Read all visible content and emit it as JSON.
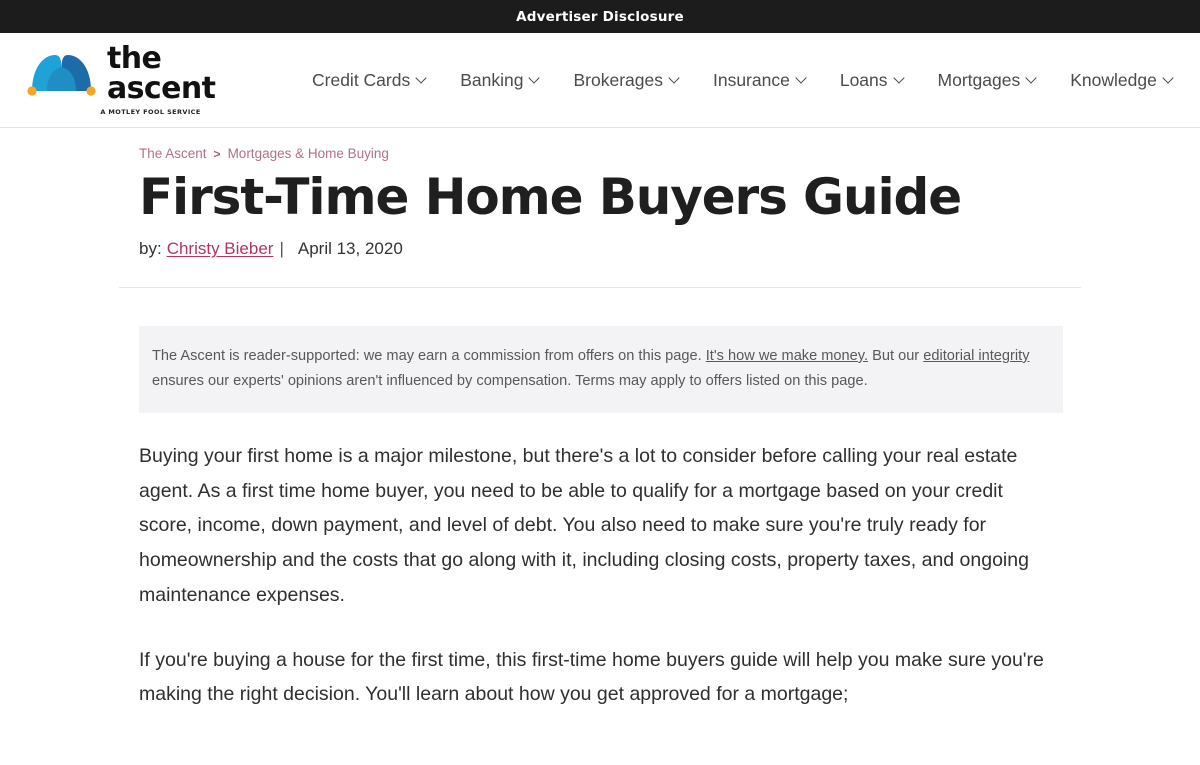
{
  "top_bar": {
    "disclosure_label": "Advertiser Disclosure",
    "background": "#1c1c1c"
  },
  "header": {
    "brand": {
      "wordmark": "the ascent",
      "tagline": "A MOTLEY FOOL SERVICE",
      "logo_icon": "jester-cap-icon",
      "logo_colors": {
        "left_hump": "#1ea2d8",
        "right_hump": "#1b6ca8",
        "center": "#1f8ec4",
        "bells": "#f5a623"
      }
    },
    "nav_items": [
      {
        "label": "Credit Cards",
        "has_dropdown": true
      },
      {
        "label": "Banking",
        "has_dropdown": true
      },
      {
        "label": "Brokerages",
        "has_dropdown": true
      },
      {
        "label": "Insurance",
        "has_dropdown": true
      },
      {
        "label": "Loans",
        "has_dropdown": true
      },
      {
        "label": "Mortgages",
        "has_dropdown": true
      },
      {
        "label": "Knowledge",
        "has_dropdown": true
      }
    ],
    "search_icon": "search-icon",
    "search_icon_color": "#2b4a63"
  },
  "article": {
    "breadcrumb": {
      "items": [
        "The Ascent",
        "Mortgages & Home Buying"
      ],
      "separator": ">",
      "link_color": "#b07188"
    },
    "title": "First-Time Home Buyers Guide",
    "byline": {
      "prefix": "by:",
      "author": "Christy Bieber",
      "separator": "|",
      "date": "April 13, 2020",
      "author_link_color": "#b4355f"
    },
    "disclaimer": {
      "background": "#f3f3f5",
      "text_before_link1": "The Ascent is reader-supported: we may earn a commission from offers on this page. ",
      "link1": "It's how we make money.",
      "text_between": " But our ",
      "link2": "editorial integrity",
      "text_after": " ensures our experts' opinions aren't influenced by compensation. Terms may apply to offers listed on this page."
    },
    "paragraphs": [
      "Buying your first home is a major milestone, but there's a lot to consider before calling your real estate agent. As a first time home buyer, you need to be able to qualify for a mortgage based on your credit score, income, down payment, and level of debt. You also need to make sure you're truly ready for homeownership and the costs that go along with it, including closing costs, property taxes, and ongoing maintenance expenses.",
      "If you're buying a house for the first time, this first-time home buyers guide will help you make sure you're making the right decision. You'll learn about how you get approved for a mortgage;"
    ]
  }
}
